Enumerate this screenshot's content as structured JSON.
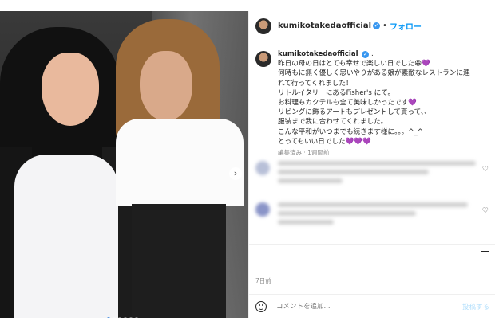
{
  "post": {
    "username": "kumikotakedaofficial",
    "follow_label": "フォロー",
    "caption_lines": [
      "昨日の母の日はとても幸せで楽しい日でした😀💜",
      "何時もに無く優しく思いやりがある娘が素敵なレストランに連",
      "れて行ってくれました！",
      "リトルイタリーにあるFisher's にて。",
      "お料理もカクテルも全て美味しかったです💜",
      "リビングに飾るアートもプレゼントして貰って、、",
      "服装まで我に合わせてくれました。",
      "こんな平和がいつまでも続きます様に。。。^_^",
      "とってもいい日でした💜💜💜"
    ],
    "meta": "編集済み · 1週間前",
    "date": "7日前",
    "comment_placeholder": "コメントを追加...",
    "post_label": "投稿する",
    "caption_suffix": "."
  },
  "icons": {
    "verified": "verified-badge-icon",
    "heart": "heart-icon",
    "bookmark": "bookmark-icon",
    "emoji": "emoji-icon",
    "next": "chevron-right-icon"
  },
  "carousel": {
    "count": 6,
    "active": 1
  },
  "colors": {
    "accent": "#0095f6",
    "verified": "#3897f0"
  }
}
